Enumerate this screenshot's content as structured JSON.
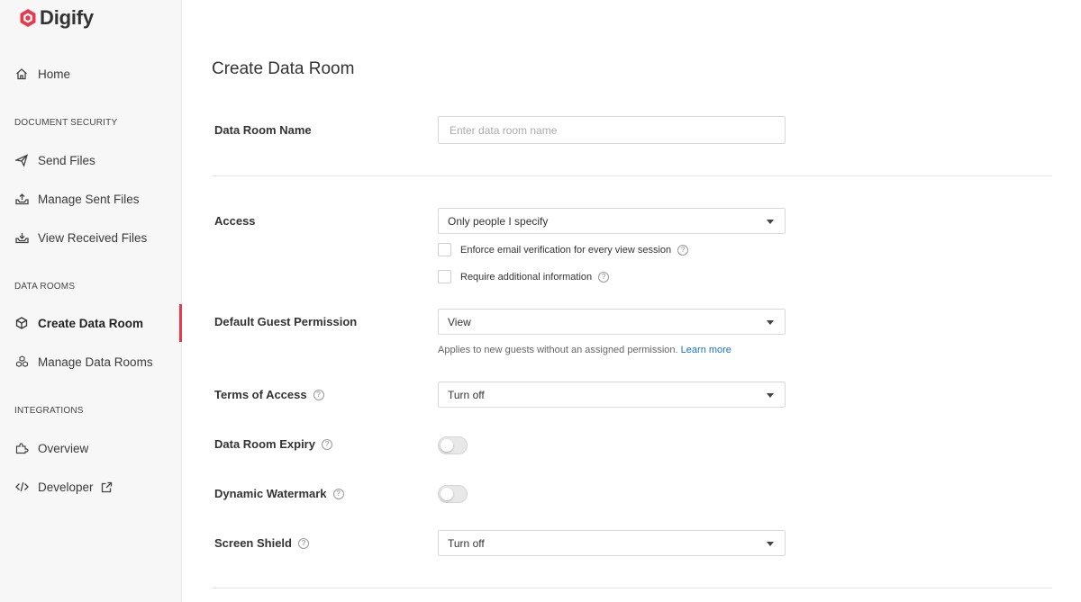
{
  "app": {
    "name": "Digify",
    "brand_color": "#e8394d"
  },
  "sidebar": {
    "home": {
      "label": "Home",
      "icon": "home-icon"
    },
    "sections": {
      "document_security": "DOCUMENT SECURITY",
      "data_rooms": "DATA ROOMS",
      "integrations": "INTEGRATIONS"
    },
    "document_security_items": [
      {
        "label": "Send Files",
        "icon": "send-icon"
      },
      {
        "label": "Manage Sent Files",
        "icon": "tray-upload-icon"
      },
      {
        "label": "View Received Files",
        "icon": "tray-download-icon"
      }
    ],
    "data_room_items": [
      {
        "label": "Create Data Room",
        "icon": "cube-icon",
        "active": true
      },
      {
        "label": "Manage Data Rooms",
        "icon": "cubes-icon"
      }
    ],
    "integration_items": [
      {
        "label": "Overview",
        "icon": "puzzle-icon"
      },
      {
        "label": "Developer",
        "icon": "code-icon",
        "external_icon": "external-link-icon"
      }
    ]
  },
  "main": {
    "title": "Create Data Room",
    "data_room_name": {
      "label": "Data Room Name",
      "placeholder": "Enter data room name",
      "value": ""
    },
    "access": {
      "label": "Access",
      "selected": "Only people I specify",
      "options": [
        {
          "label": "Enforce email verification for every view session",
          "checked": false
        },
        {
          "label": "Require additional information",
          "checked": false
        }
      ]
    },
    "default_guest_permission": {
      "label": "Default Guest Permission",
      "selected": "View",
      "hint": "Applies to new guests without an assigned permission.",
      "hint_link": "Learn more"
    },
    "terms_of_access": {
      "label": "Terms of Access",
      "selected": "Turn off"
    },
    "data_room_expiry": {
      "label": "Data Room Expiry",
      "enabled": false
    },
    "dynamic_watermark": {
      "label": "Dynamic Watermark",
      "enabled": false
    },
    "screen_shield": {
      "label": "Screen Shield",
      "selected": "Turn off"
    },
    "help_icon_glyph": "?"
  }
}
